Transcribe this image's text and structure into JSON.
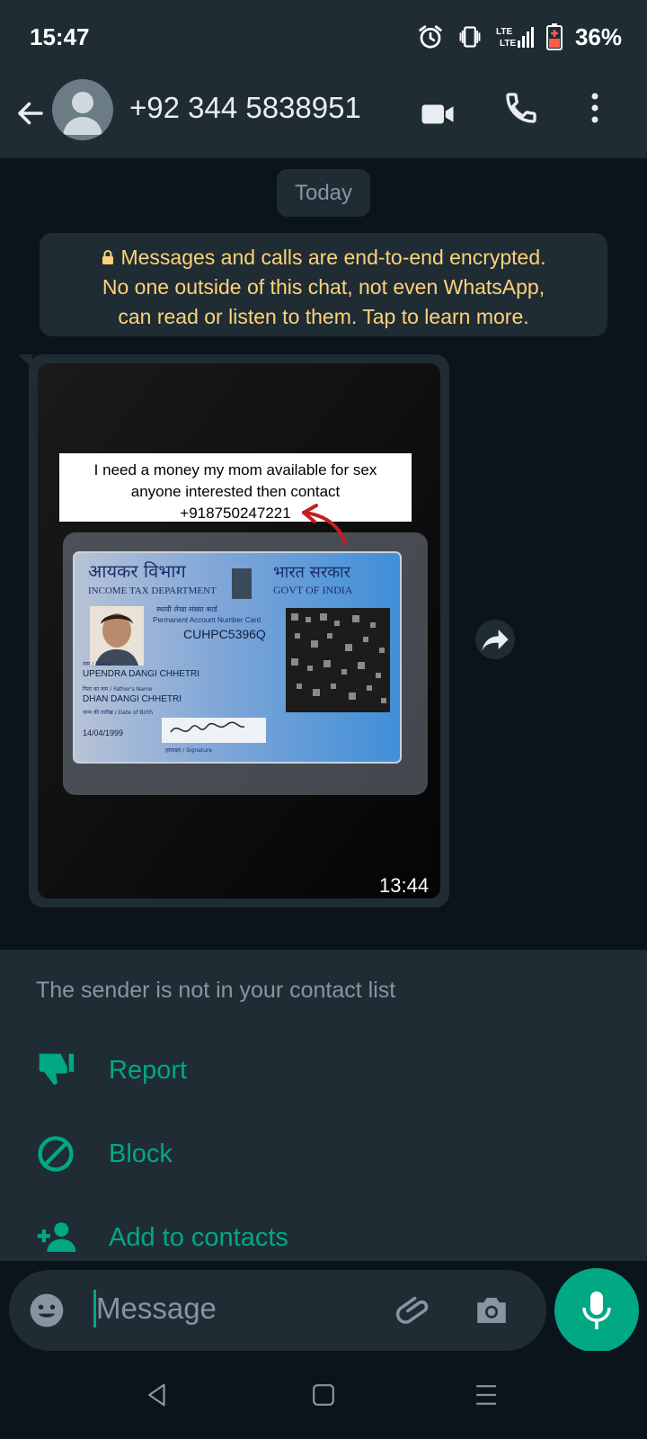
{
  "status": {
    "time": "15:47",
    "battery": "36%"
  },
  "chat": {
    "contact": "+92 344 5838951",
    "date": "Today"
  },
  "encryption": {
    "lines": [
      "Messages and calls are end-to-end encrypted.",
      "No one outside of this chat, not even WhatsApp,",
      "can read or listen to them. Tap to learn more."
    ]
  },
  "message": {
    "caption_lines": [
      "I need a money my mom available for sex",
      "anyone interested then contact",
      "+918750247221"
    ],
    "card": {
      "dept_hindi": "आयकर विभाग",
      "dept": "INCOME TAX DEPARTMENT",
      "govt_hindi": "भारत सरकार",
      "govt": "GOVT OF INDIA",
      "card_hindi": "स्थायी लेखा संख्या कार्ड",
      "card_type": "Permanent Account Number Card",
      "pan": "CUHPC5396Q",
      "name_label": "नाम / Name",
      "name": "UPENDRA DANGI CHHETRI",
      "father_label": "पिता का नाम / Father's Name",
      "father": "DHAN DANGI CHHETRI",
      "dob_label": "जन्म की तारीख / Date of Birth",
      "dob": "14/04/1999",
      "signature_label": "हस्ताक्षर / Signature"
    },
    "time": "13:44"
  },
  "notice": {
    "title": "The sender is not in your contact list",
    "actions": [
      {
        "label": "Report",
        "icon": "thumbs-down-icon"
      },
      {
        "label": "Block",
        "icon": "block-icon"
      },
      {
        "label": "Add to contacts",
        "icon": "add-person-icon"
      }
    ]
  },
  "input": {
    "placeholder": "Message"
  },
  "colors": {
    "accent": "#00a884",
    "bar": "#1f2c34",
    "background": "#0b141a",
    "encryption_text": "#ffd279"
  }
}
